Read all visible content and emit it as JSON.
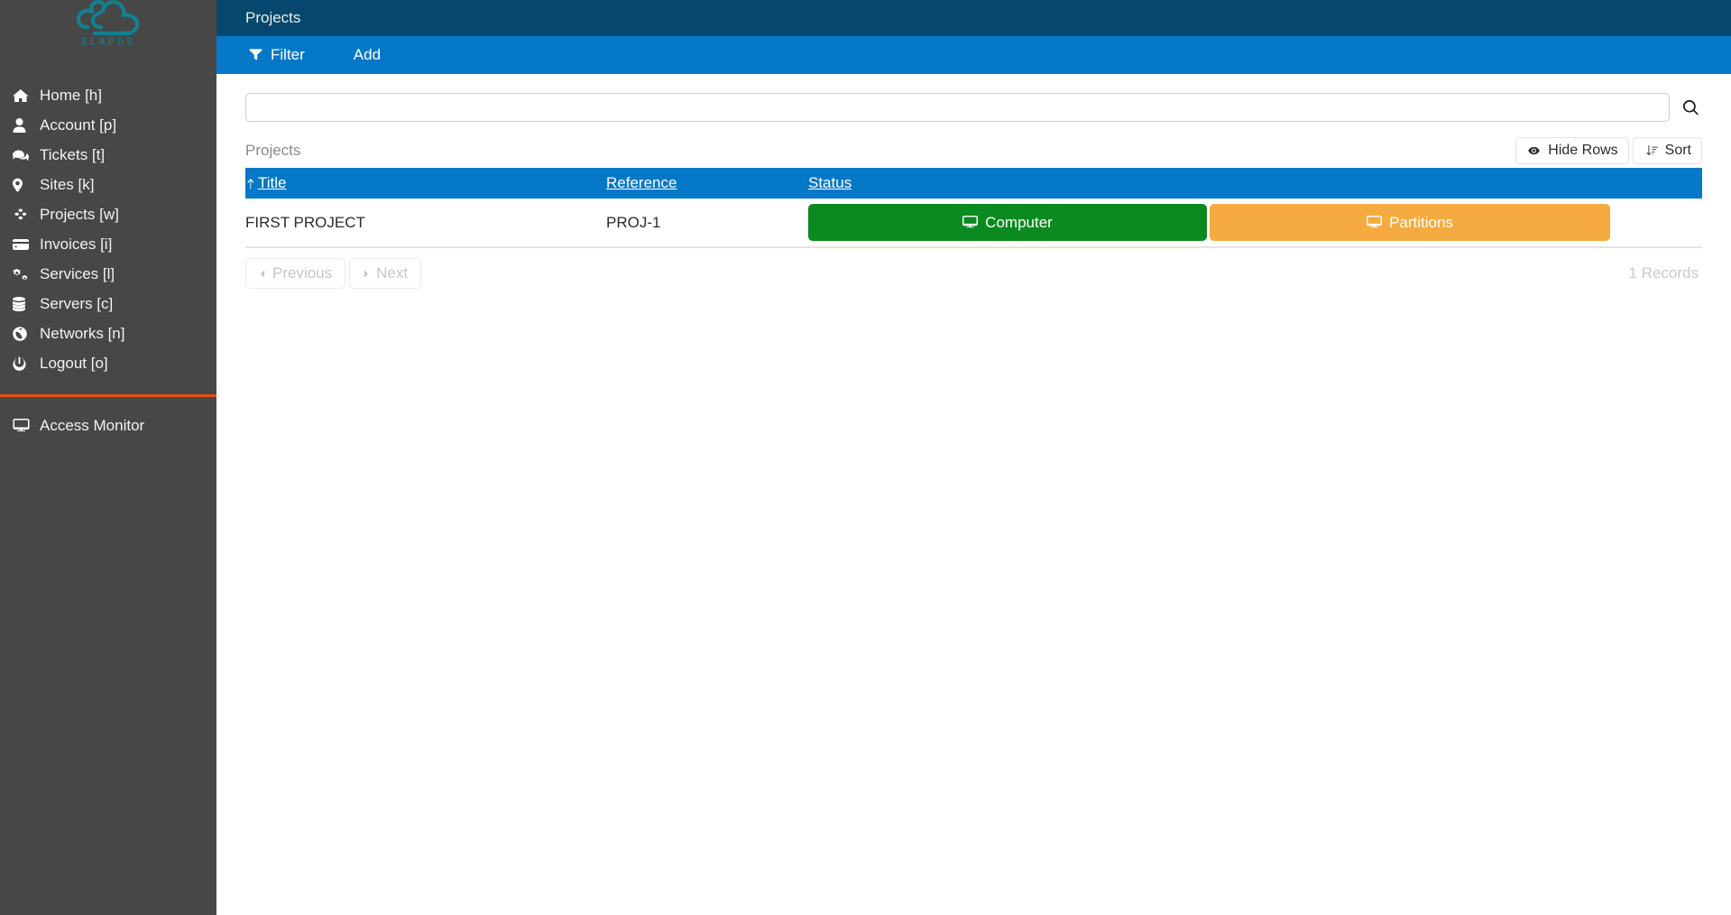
{
  "brand": {
    "name": "SLAPOS",
    "logo_icon": "slapos-cloud-logo",
    "logo_color": "#12818f"
  },
  "sidebar": {
    "background_color": "#474747",
    "divider_color": "#e8500e",
    "items": [
      {
        "label": "Home [h]",
        "icon": "home-icon",
        "key": "home"
      },
      {
        "label": "Account [p]",
        "icon": "user-icon",
        "key": "account"
      },
      {
        "label": "Tickets [t]",
        "icon": "comments-icon",
        "key": "tickets"
      },
      {
        "label": "Sites [k]",
        "icon": "map-marker-icon",
        "key": "sites"
      },
      {
        "label": "Projects [w]",
        "icon": "cubes-icon",
        "key": "projects"
      },
      {
        "label": "Invoices [i]",
        "icon": "credit-card-icon",
        "key": "invoices"
      },
      {
        "label": "Services [l]",
        "icon": "cogs-icon",
        "key": "services"
      },
      {
        "label": "Servers [c]",
        "icon": "database-icon",
        "key": "servers"
      },
      {
        "label": "Networks [n]",
        "icon": "globe-icon",
        "key": "networks"
      },
      {
        "label": "Logout [o]",
        "icon": "power-off-icon",
        "key": "logout"
      }
    ],
    "bottom_items": [
      {
        "label": "Access Monitor",
        "icon": "desktop-icon",
        "key": "access-monitor"
      }
    ]
  },
  "topbar": {
    "title": "Projects",
    "background_color": "#06486d"
  },
  "toolbar": {
    "background_color": "#0579c8",
    "filter_label": "Filter",
    "filter_icon": "filter-icon",
    "add_label": "Add"
  },
  "search": {
    "value": "",
    "placeholder": "",
    "search_icon": "search-icon"
  },
  "listing": {
    "title": "Projects",
    "hide_rows_label": "Hide Rows",
    "hide_rows_icon": "eye-icon",
    "sort_label": "Sort",
    "sort_icon": "sort-amount-down-icon"
  },
  "table": {
    "header_color": "#0579c8",
    "sort_indicator_icon": "arrow-up-icon",
    "columns": [
      {
        "label": "Title",
        "sorted": true,
        "direction": "asc"
      },
      {
        "label": "Reference",
        "sorted": false
      },
      {
        "label": "Status",
        "sorted": false
      }
    ],
    "rows": [
      {
        "title": "FIRST PROJECT",
        "reference": "PROJ-1",
        "status_buttons": [
          {
            "label": "Computer",
            "icon": "desktop-icon",
            "color": "#0b8a20"
          },
          {
            "label": "Partitions",
            "icon": "desktop-icon",
            "color": "#f5ab3f"
          }
        ]
      }
    ]
  },
  "pagination": {
    "previous_label": "Previous",
    "previous_icon": "triangle-left-icon",
    "next_label": "Next",
    "next_icon": "triangle-right-icon",
    "records_label": "1 Records"
  }
}
